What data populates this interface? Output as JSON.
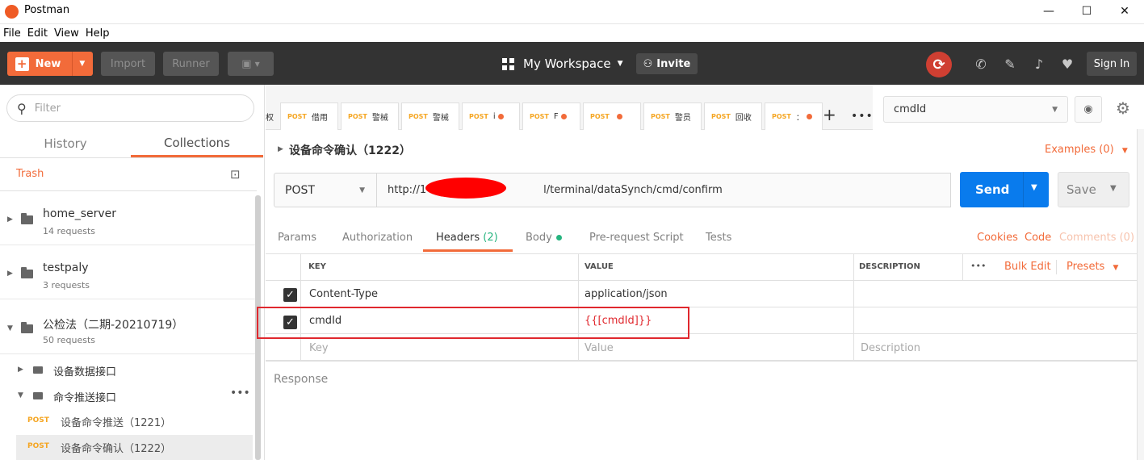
{
  "window": {
    "title": "Postman",
    "minimize": "—",
    "maximize": "☐",
    "close": "✕"
  },
  "menu": [
    "File",
    "Edit",
    "View",
    "Help"
  ],
  "toolbar": {
    "new_label": "New",
    "import_label": "Import",
    "runner_label": "Runner",
    "workspace_label": "My Workspace",
    "invite_label": "Invite",
    "signin_label": "Sign In"
  },
  "sidebar": {
    "search_placeholder": "Filter",
    "tabs": [
      "History",
      "Collections"
    ],
    "trash_label": "Trash",
    "collections": [
      {
        "name": "home_server",
        "count": "14 requests"
      },
      {
        "name": "testpaly",
        "count": "3 requests"
      },
      {
        "name": "公检法（二期-20210719）",
        "count": "50 requests"
      }
    ],
    "folders": [
      "设备数据接口",
      "命令推送接口"
    ],
    "requests": [
      {
        "method": "POST",
        "name": "设备命令推送（1221）"
      },
      {
        "method": "POST",
        "name": "设备命令确认（1222）"
      }
    ]
  },
  "request_tabs": [
    {
      "method": "",
      "name": "权"
    },
    {
      "method": "POST",
      "name": "借用"
    },
    {
      "method": "POST",
      "name": "警械"
    },
    {
      "method": "POST",
      "name": "警械"
    },
    {
      "method": "POST",
      "name": "i",
      "dirty": true
    },
    {
      "method": "POST",
      "name": "F",
      "dirty": true
    },
    {
      "method": "POST",
      "name": "",
      "dirty": true
    },
    {
      "method": "POST",
      "name": "警员"
    },
    {
      "method": "POST",
      "name": "回收"
    },
    {
      "method": "POST",
      "name": "：",
      "dirty": true
    }
  ],
  "environment": {
    "selected": "cmdId"
  },
  "request": {
    "name": "设备命令确认（1222）",
    "examples_label": "Examples (0)",
    "method": "POST",
    "url": "http://1",
    "url_suffix": "l/terminal/dataSynch/cmd/confirm",
    "send_label": "Send",
    "save_label": "Save"
  },
  "subtabs": {
    "params": "Params",
    "authorization": "Authorization",
    "headers": "Headers",
    "headers_count": "(2)",
    "body": "Body",
    "prerequest": "Pre-request Script",
    "tests": "Tests",
    "cookies": "Cookies",
    "code": "Code",
    "comments": "Comments (0)"
  },
  "headers_table": {
    "col_key": "KEY",
    "col_value": "VALUE",
    "col_desc": "DESCRIPTION",
    "more": "•••",
    "bulk_edit": "Bulk Edit",
    "presets": "Presets",
    "rows": [
      {
        "key": "Content-Type",
        "value": "application/json"
      },
      {
        "key": "cmdId",
        "value": "{{[cmdId]}}"
      }
    ],
    "placeholder_key": "Key",
    "placeholder_value": "Value",
    "placeholder_desc": "Description"
  },
  "response_label": "Response",
  "colors": {
    "accent": "#f26b3a",
    "send": "#097bed",
    "toolbar": "#333333",
    "highlight": "#e0282e"
  }
}
